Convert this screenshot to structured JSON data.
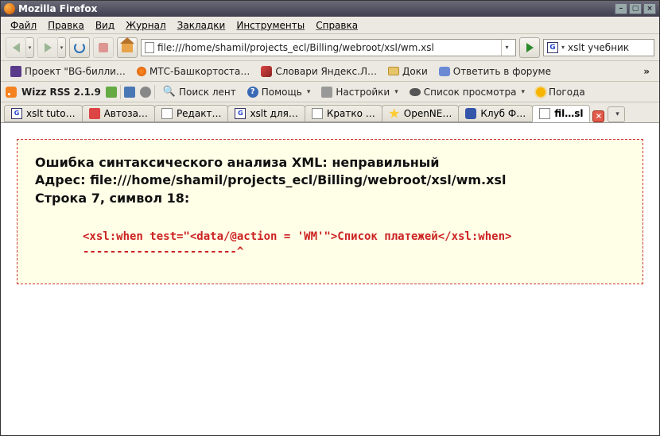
{
  "window": {
    "title": "Mozilla Firefox"
  },
  "menu": {
    "items": [
      "Файл",
      "Правка",
      "Вид",
      "Журнал",
      "Закладки",
      "Инструменты",
      "Справка"
    ]
  },
  "toolbar": {
    "url": "file:///home/shamil/projects_ecl/Billing/webroot/xsl/wm.xsl",
    "search_engine_letter": "G",
    "search_text": "xslt учебник"
  },
  "bookmarks": {
    "items": [
      {
        "label": "Проект \"BG-билли…",
        "icon": "sq-purple"
      },
      {
        "label": "МТС-Башкортоста…",
        "icon": "dot-orange"
      },
      {
        "label": "Словари Яндекс.Л…",
        "icon": "rocket"
      },
      {
        "label": "Доки",
        "icon": "folder"
      },
      {
        "label": "Ответить в форуме",
        "icon": "chat"
      }
    ],
    "overflow": "»"
  },
  "rssbar": {
    "app": "Wizz RSS 2.1.9",
    "buttons": [
      {
        "label": "Поиск лент",
        "icon": "search",
        "drop": false
      },
      {
        "label": "Помощь",
        "icon": "qmark",
        "drop": true
      },
      {
        "label": "Настройки",
        "icon": "wrench",
        "drop": true
      },
      {
        "label": "Список просмотра",
        "icon": "eye",
        "drop": true
      },
      {
        "label": "Погода",
        "icon": "sun",
        "drop": false
      }
    ]
  },
  "tabs": {
    "items": [
      {
        "label": "xslt tuto…",
        "fav": "fv-g"
      },
      {
        "label": "Автоза…",
        "fav": "fv-gear"
      },
      {
        "label": "Редакт…",
        "fav": "fv-doc"
      },
      {
        "label": "xslt для…",
        "fav": "fv-g"
      },
      {
        "label": "Кратко …",
        "fav": "fv-doc"
      },
      {
        "label": "OpenNE…",
        "fav": "fv-star"
      },
      {
        "label": "Клуб Ф…",
        "fav": "fv-car"
      },
      {
        "label": "fil…sl",
        "fav": "fv-doc",
        "active": true
      }
    ]
  },
  "error": {
    "line1": "Ошибка синтаксического анализа XML: неправильный",
    "line2": "Адрес: file:///home/shamil/projects_ecl/Billing/webroot/xsl/wm.xsl",
    "line3": "Строка 7, символ 18:",
    "code": "<xsl:when test=\"<data/@action = 'WM'\">Список платежей</xsl:when>",
    "caret": "-----------------------^"
  }
}
